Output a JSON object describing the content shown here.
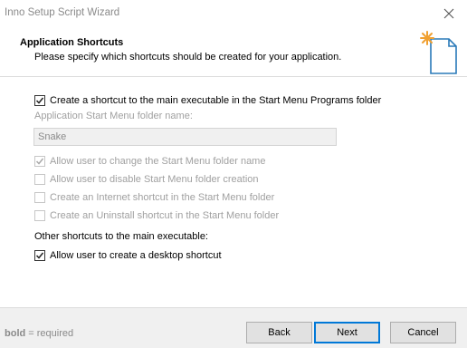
{
  "window": {
    "title": "Inno Setup Script Wizard"
  },
  "header": {
    "title": "Application Shortcuts",
    "subtitle": "Please specify which shortcuts should be created for your application."
  },
  "options": {
    "start_menu_shortcut": {
      "label": "Create a shortcut to the main executable in the Start Menu Programs folder",
      "checked": true,
      "enabled": true
    },
    "folder_name_label": "Application Start Menu folder name:",
    "folder_name_value": "Snake",
    "allow_change_folder": {
      "label": "Allow user to change the Start Menu folder name",
      "checked": true,
      "enabled": false
    },
    "allow_disable_folder": {
      "label": "Allow user to disable Start Menu folder creation",
      "checked": false,
      "enabled": false
    },
    "internet_shortcut": {
      "label": "Create an Internet shortcut in the Start Menu folder",
      "checked": false,
      "enabled": false
    },
    "uninstall_shortcut": {
      "label": "Create an Uninstall shortcut in the Start Menu folder",
      "checked": false,
      "enabled": false
    },
    "other_shortcuts_label": "Other shortcuts to the main executable:",
    "desktop_shortcut": {
      "label": "Allow user to create a desktop shortcut",
      "checked": true,
      "enabled": true
    }
  },
  "footer": {
    "note_bold": "bold",
    "note_rest": " = required",
    "back_label": "Back",
    "next_label": "Next",
    "cancel_label": "Cancel"
  },
  "colors": {
    "accent": "#0078d7",
    "footer_bg": "#f0f0f0",
    "disabled_text": "#a0a0a0"
  },
  "icons": [
    "close-icon",
    "wizard-document-icon",
    "checkmark-icon"
  ]
}
